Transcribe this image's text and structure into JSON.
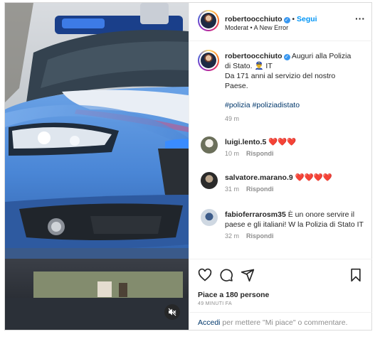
{
  "post": {
    "author": "robertoocchiuto",
    "follow_label": "Segui",
    "separator": "•",
    "audio": "Moderat • A New Error",
    "more_icon": "more-horizontal-icon",
    "caption": {
      "line1": "Auguri alla Polizia",
      "line2": "di Stato. 👮‍♂️ IT",
      "line3": "Da 171 anni al servizio del nostro",
      "line4": "Paese.",
      "hashtags": "#polizia #poliziadistato",
      "time": "49 m"
    }
  },
  "comments": [
    {
      "user": "luigi.lento.5",
      "text": "❤️❤️❤️",
      "time": "10 m",
      "reply": "Rispondi"
    },
    {
      "user": "salvatore.marano.9",
      "text": "❤️❤️❤️❤️",
      "time": "31 m",
      "reply": "Rispondi"
    },
    {
      "user": "fabioferrarosm35",
      "text_line1": "È un onore servire il",
      "text_line2": "paese e gli italiani! W la Polizia di Stato IT",
      "time": "32 m",
      "reply": "Rispondi"
    }
  ],
  "actions": {
    "icons": [
      "heart-icon",
      "comment-icon",
      "share-icon",
      "bookmark-icon"
    ],
    "likes": "Piace a 180 persone",
    "time": "49 MINUTI FA",
    "add_comment_link": "Accedi",
    "add_comment_rest": " per mettere \"Mi piace\" o commentare."
  },
  "colors": {
    "link_blue": "#0095f6",
    "police_blue": "#4a86d6",
    "heart_red": "#ed4956"
  }
}
